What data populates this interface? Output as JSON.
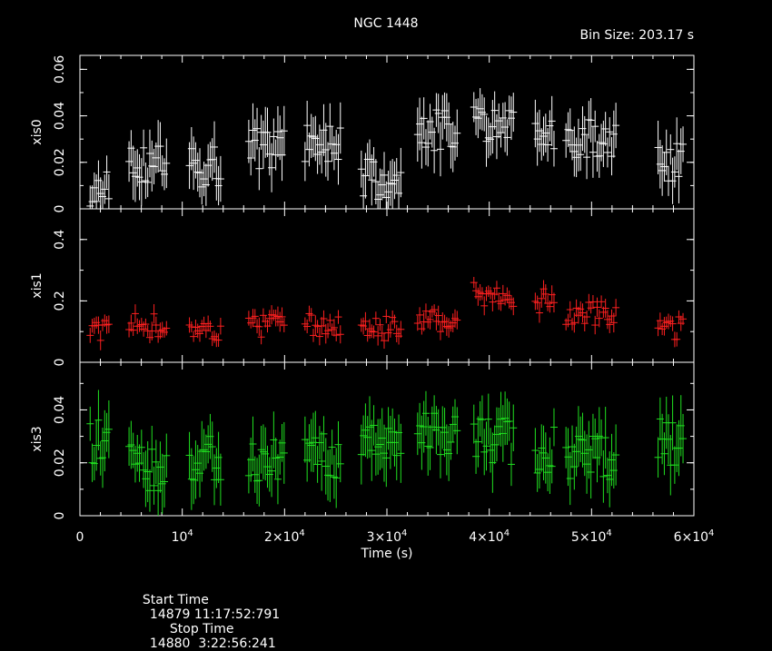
{
  "title": "NGC 1448",
  "bin_size": "Bin Size: 203.17 s",
  "footer": {
    "start_label": "Start Time",
    "start_value": "14879 11:17:52:791",
    "stop_label": "Stop Time",
    "stop_value": "14880  3:22:56:241"
  },
  "chart_data": {
    "type": "scatter",
    "xlabel": "Time (s)",
    "xlim": [
      0,
      60000
    ],
    "xticks": [
      {
        "value": 0,
        "label": "0"
      },
      {
        "value": 10000,
        "label": "10",
        "exp": "4"
      },
      {
        "value": 20000,
        "label": "2×10",
        "exp": "4"
      },
      {
        "value": 30000,
        "label": "3×10",
        "exp": "4"
      },
      {
        "value": 40000,
        "label": "4×10",
        "exp": "4"
      },
      {
        "value": 50000,
        "label": "5×10",
        "exp": "4"
      },
      {
        "value": 60000,
        "label": "6×10",
        "exp": "4"
      }
    ],
    "bin_width": 203.17,
    "segments": [
      [
        1000,
        3000
      ],
      [
        4800,
        8500
      ],
      [
        10700,
        13900
      ],
      [
        16500,
        20000
      ],
      [
        22000,
        25600
      ],
      [
        27500,
        31400
      ],
      [
        33000,
        37000
      ],
      [
        38500,
        42500
      ],
      [
        44500,
        46500
      ],
      [
        47500,
        52500
      ],
      [
        56500,
        59000
      ]
    ],
    "panels": [
      {
        "name": "xis0",
        "color": "#ffffff",
        "ylim": [
          0,
          0.066
        ],
        "yticks": [
          0,
          0.02,
          0.04,
          0.06
        ],
        "ytick_labels": [
          "0",
          "0.02",
          "0.04",
          "0.06"
        ],
        "base": [
          0.01,
          0.02,
          0.018,
          0.026,
          0.028,
          0.013,
          0.034,
          0.035,
          0.032,
          0.03,
          0.02
        ],
        "noise": 0.009,
        "err": 0.009
      },
      {
        "name": "xis1",
        "color": "#ff2020",
        "ylim": [
          0,
          0.5
        ],
        "yticks": [
          0,
          0.2,
          0.4
        ],
        "ytick_labels": [
          "0",
          "0.2",
          "0.4"
        ],
        "base": [
          0.1,
          0.12,
          0.1,
          0.12,
          0.12,
          0.11,
          0.14,
          0.22,
          0.2,
          0.16,
          0.11
        ],
        "noise": 0.04,
        "err": 0.025
      },
      {
        "name": "xis3",
        "color": "#20e020",
        "ylim": [
          0,
          0.058
        ],
        "yticks": [
          0,
          0.02,
          0.04
        ],
        "ytick_labels": [
          "0",
          "0.02",
          "0.04"
        ],
        "base": [
          0.028,
          0.018,
          0.022,
          0.022,
          0.022,
          0.03,
          0.03,
          0.028,
          0.025,
          0.022,
          0.028
        ],
        "noise": 0.009,
        "err": 0.009
      }
    ]
  }
}
